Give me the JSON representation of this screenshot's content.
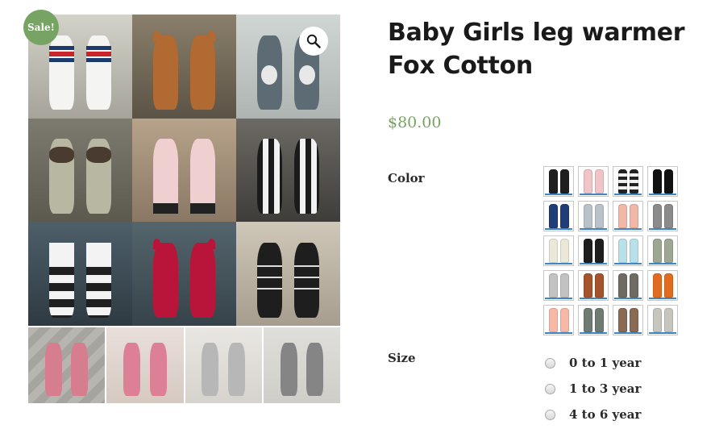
{
  "product": {
    "title": "Baby Girls leg warmer Fox Cotton",
    "price": "$80.00",
    "sale_badge": "Sale!"
  },
  "gallery": {
    "zoom_icon": "magnifier-icon",
    "image_count": 9,
    "thumbnail_count": 4
  },
  "attributes": {
    "color": {
      "label": "Color",
      "swatch_count": 20,
      "swatches": [
        {
          "a": "#1f1f1f",
          "b": "#1f1f1f"
        },
        {
          "a": "#f1c4c8",
          "b": "#f1c4c8"
        },
        {
          "a": "#222222",
          "b": "#f0f0f0"
        },
        {
          "a": "#111111",
          "b": "#111111"
        },
        {
          "a": "#1f3e78",
          "b": "#1f3e78"
        },
        {
          "a": "#b9c2c9",
          "b": "#b9c2c9"
        },
        {
          "a": "#f2b7a7",
          "b": "#f2b7a7"
        },
        {
          "a": "#8b8b8b",
          "b": "#8b8b8b"
        },
        {
          "a": "#ece8d8",
          "b": "#ece8d8"
        },
        {
          "a": "#1d1d1d",
          "b": "#1d1d1d"
        },
        {
          "a": "#b8e0ea",
          "b": "#b8e0ea"
        },
        {
          "a": "#9ea793",
          "b": "#9ea793"
        },
        {
          "a": "#c2c2c2",
          "b": "#c2c2c2"
        },
        {
          "a": "#a4532a",
          "b": "#a4532a"
        },
        {
          "a": "#6f6a62",
          "b": "#6f6a62"
        },
        {
          "a": "#e36b1f",
          "b": "#e36b1f"
        },
        {
          "a": "#f7b9a5",
          "b": "#f7b9a5"
        },
        {
          "a": "#6f7a72",
          "b": "#6f7a72"
        },
        {
          "a": "#8a6a52",
          "b": "#8a6a52"
        },
        {
          "a": "#c7c5bd",
          "b": "#c7c5bd"
        }
      ]
    },
    "size": {
      "label": "Size",
      "options": [
        "0 to 1 year",
        "1 to 3 year",
        "4 to 6 year"
      ]
    }
  },
  "colors": {
    "accent": "#77a464",
    "swatch_underline": "#3d87c6"
  }
}
